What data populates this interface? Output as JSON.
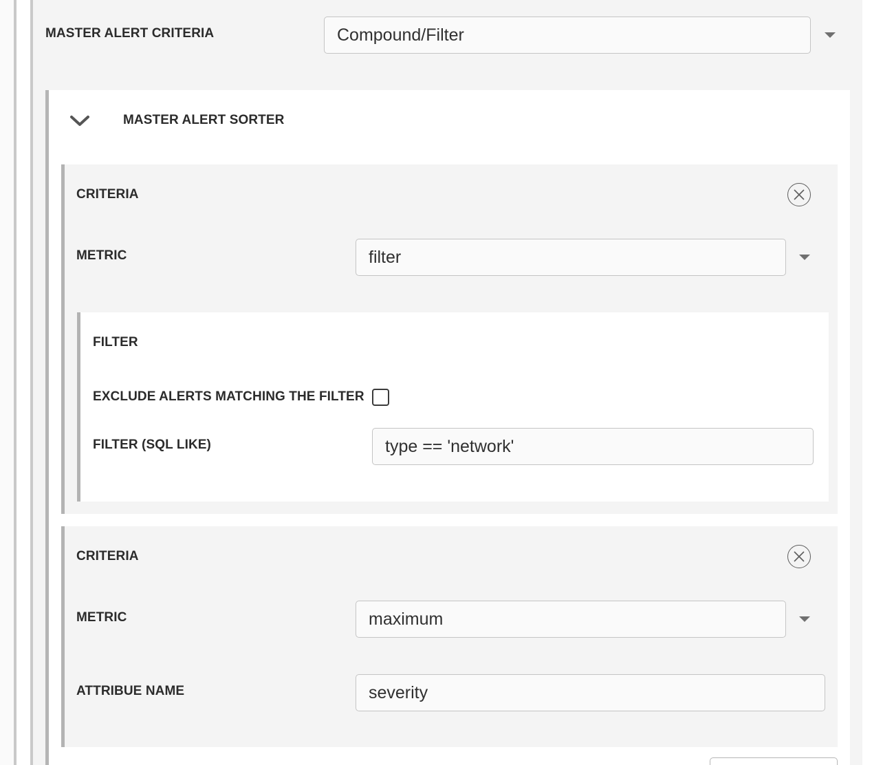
{
  "master_criteria": {
    "label": "MASTER ALERT CRITERIA",
    "selected_value": "Compound/Filter"
  },
  "sorter": {
    "title": "MASTER ALERT SORTER",
    "expand_icon": "chevron-down-icon"
  },
  "criteria_1": {
    "title": "CRITERIA",
    "remove_icon": "close-circle-icon",
    "metric_label": "METRIC",
    "metric_value": "filter",
    "filter": {
      "title": "FILTER",
      "exclude_label": "EXCLUDE ALERTS MATCHING THE FILTER",
      "exclude_checked": false,
      "sql_label": "FILTER (SQL LIKE)",
      "sql_value": "type == 'network'"
    }
  },
  "criteria_2": {
    "title": "CRITERIA",
    "remove_icon": "close-circle-icon",
    "metric_label": "METRIC",
    "metric_value": "maximum",
    "attribute_label": "ATTRIBUE NAME",
    "attribute_value": "severity"
  }
}
